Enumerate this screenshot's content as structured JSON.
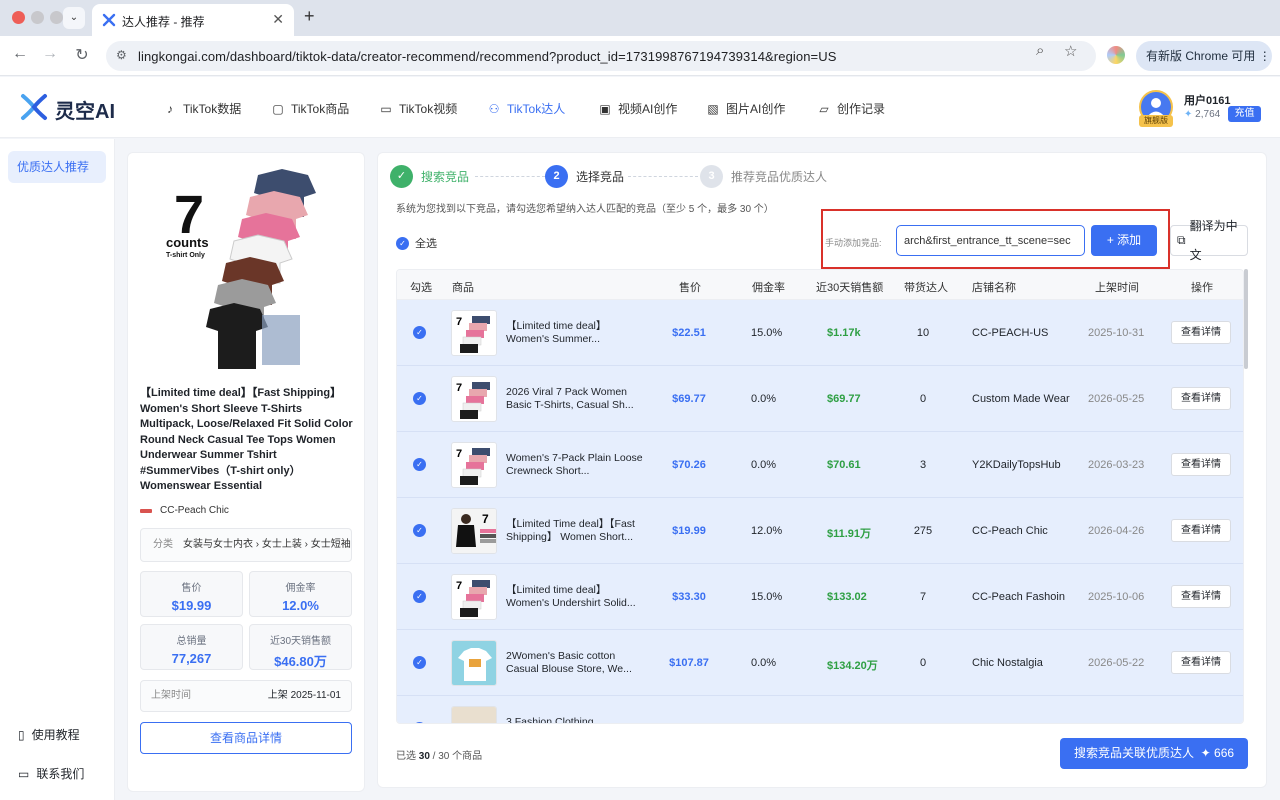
{
  "browser": {
    "tab_title": "达人推荐 - 推荐",
    "url": "lingkongai.com/dashboard/tiktok-data/creator-recommend/recommend?product_id=1731998767194739314&region=US",
    "update_label": "有新版 Chrome 可用"
  },
  "header": {
    "logo_text": "灵空AI",
    "nav": [
      {
        "label": "TikTok数据",
        "icon": "tiktok-icon"
      },
      {
        "label": "TikTok商品",
        "icon": "bag-icon"
      },
      {
        "label": "TikTok视频",
        "icon": "video-icon"
      },
      {
        "label": "TikTok达人",
        "icon": "users-icon",
        "active": true
      },
      {
        "label": "视频AI创作",
        "icon": "video-ai-icon"
      },
      {
        "label": "图片AI创作",
        "icon": "image-icon"
      },
      {
        "label": "创作记录",
        "icon": "folder-icon"
      }
    ],
    "user": {
      "name": "用户0161",
      "badge": "旗舰版",
      "points": "2,764",
      "recharge": "充值"
    }
  },
  "sidebar": {
    "active_item": "优质达人推荐",
    "bottom": [
      {
        "label": "使用教程",
        "icon": "book-icon"
      },
      {
        "label": "联系我们",
        "icon": "chat-icon"
      }
    ]
  },
  "product": {
    "img_counts": "7",
    "img_counts_word": "counts",
    "img_subtitle": "T-shirt Only",
    "title": "【Limited time deal】【Fast Shipping】 Women's Short Sleeve T-Shirts Multipack, Loose/Relaxed Fit Solid Color Round Neck Casual Tee Tops Women Underwear Summer Tshirt #SummerVibes（T-shirt only） Womenswear Essential",
    "shop": "CC-Peach Chic",
    "category_label": "分类",
    "category": "女装与女士内衣 › 女士上装 › 女士短袖",
    "stats": [
      {
        "label": "售价",
        "value": "$19.99"
      },
      {
        "label": "佣金率",
        "value": "12.0%"
      },
      {
        "label": "总销量",
        "value": "77,267"
      },
      {
        "label": "近30天销售额",
        "value": "$46.80万"
      }
    ],
    "list_time_label": "上架时间",
    "list_time_value": "上架 2025-11-01",
    "detail_button": "查看商品详情"
  },
  "steps": [
    {
      "num": "✓",
      "label": "搜索竞品",
      "state": "done"
    },
    {
      "num": "2",
      "label": "选择竞品",
      "state": "active"
    },
    {
      "num": "3",
      "label": "推荐竞品优质达人",
      "state": "pending"
    }
  ],
  "hint": "系统为您找到以下竞品，请勾选您希望纳入达人匹配的竞品（至少 5 个，最多 30 个）",
  "select_all": "全选",
  "manual": {
    "label": "手动添加竞品:",
    "value": "arch&first_entrance_tt_scene=sec",
    "add_button": "+ 添加",
    "translate_button": "翻译为中文"
  },
  "table": {
    "headers": [
      "勾选",
      "商品",
      "售价",
      "佣金率",
      "近30天销售额",
      "带货达人",
      "店铺名称",
      "上架时间",
      "操作"
    ],
    "view_label": "查看详情",
    "rows": [
      {
        "name": "【Limited time deal】 Women's Summer...",
        "price": "$22.51",
        "commission": "15.0%",
        "sales": "$1.17k",
        "creators": "10",
        "shop": "CC-PEACH-US",
        "date": "2025-10-31",
        "thumb": "stack"
      },
      {
        "name": "2026 Viral 7 Pack Women Basic T-Shirts, Casual Sh...",
        "price": "$69.77",
        "commission": "0.0%",
        "sales": "$69.77",
        "creators": "0",
        "shop": "Custom Made Wear",
        "date": "2026-05-25",
        "thumb": "stack"
      },
      {
        "name": "Women's 7-Pack Plain Loose Crewneck Short...",
        "price": "$70.26",
        "commission": "0.0%",
        "sales": "$70.61",
        "creators": "3",
        "shop": "Y2KDailyTopsHub",
        "date": "2026-03-23",
        "thumb": "stack"
      },
      {
        "name": "【Limited Time deal】【Fast Shipping】 Women Short...",
        "price": "$19.99",
        "commission": "12.0%",
        "sales": "$11.91万",
        "creators": "275",
        "shop": "CC-Peach Chic",
        "date": "2026-04-26",
        "thumb": "model"
      },
      {
        "name": "【Limited time deal】 Women's Undershirt Solid...",
        "price": "$33.30",
        "commission": "15.0%",
        "sales": "$133.02",
        "creators": "7",
        "shop": "CC-Peach Fashoin",
        "date": "2025-10-06",
        "thumb": "stack"
      },
      {
        "name": "2Women's Basic cotton Casual Blouse Store, We...",
        "price": "$107.87",
        "commission": "0.0%",
        "sales": "$134.20万",
        "creators": "0",
        "shop": "Chic Nostalgia",
        "date": "2026-05-22",
        "thumb": "tee"
      },
      {
        "name": "3 Fashion Clothing",
        "price": "",
        "commission": "",
        "sales": "",
        "creators": "",
        "shop": "",
        "date": "",
        "thumb": "plain"
      }
    ]
  },
  "footer": {
    "selected_prefix": "已选 ",
    "selected_count": "30",
    "selected_suffix": " / 30 个商品",
    "search_button": "搜索竞品关联优质达人",
    "search_cost": "✦ 666"
  },
  "colors": {
    "accent": "#3a6ff2",
    "success": "#2e9f43",
    "highlight": "#d9312a",
    "row_selected": "#e6eefd"
  }
}
